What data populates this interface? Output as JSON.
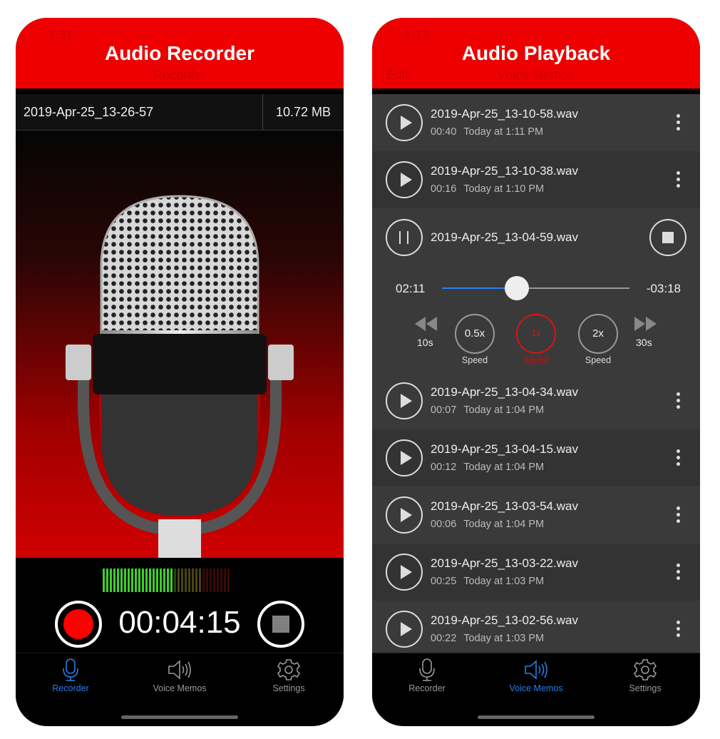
{
  "recorder": {
    "status_time": "1:31",
    "title": "Audio Recorder",
    "nav_title": "Recorder",
    "filename": "2019-Apr-25_13-26-57",
    "filesize": "10.72 MB",
    "timer": "00:04:15",
    "meter_level": 0.55,
    "colors": {
      "accent": "#ee0000",
      "record": "#ff0000",
      "tab_active": "#2a7ee8"
    }
  },
  "playback": {
    "status_time": "1:13",
    "title": "Audio Playback",
    "nav_left": "Edit",
    "nav_title": "Voice Memos",
    "rows_before": [
      {
        "name": "2019-Apr-25_13-10-58.wav",
        "duration": "00:40",
        "date": "Today at 1:11 PM"
      },
      {
        "name": "2019-Apr-25_13-10-38.wav",
        "duration": "00:16",
        "date": "Today at 1:10 PM"
      }
    ],
    "expanded": {
      "name": "2019-Apr-25_13-04-59.wav",
      "elapsed": "02:11",
      "remaining": "-03:18",
      "progress": 0.4,
      "rewind_label": "10s",
      "forward_label": "30s",
      "speeds": [
        {
          "value": "0.5x",
          "label": "Speed"
        },
        {
          "value": "1x",
          "label": "Speed",
          "active": true
        },
        {
          "value": "2x",
          "label": "Speed"
        }
      ]
    },
    "rows_after": [
      {
        "name": "2019-Apr-25_13-04-34.wav",
        "duration": "00:07",
        "date": "Today at 1:04 PM"
      },
      {
        "name": "2019-Apr-25_13-04-15.wav",
        "duration": "00:12",
        "date": "Today at 1:04 PM"
      },
      {
        "name": "2019-Apr-25_13-03-54.wav",
        "duration": "00:06",
        "date": "Today at 1:04 PM"
      },
      {
        "name": "2019-Apr-25_13-03-22.wav",
        "duration": "00:25",
        "date": "Today at 1:03 PM"
      },
      {
        "name": "2019-Apr-25_13-02-56.wav",
        "duration": "00:22",
        "date": "Today at 1:03 PM"
      }
    ]
  },
  "tabs": [
    {
      "label": "Recorder",
      "icon": "microphone-icon"
    },
    {
      "label": "Voice Memos",
      "icon": "speaker-icon"
    },
    {
      "label": "Settings",
      "icon": "gear-icon"
    }
  ]
}
